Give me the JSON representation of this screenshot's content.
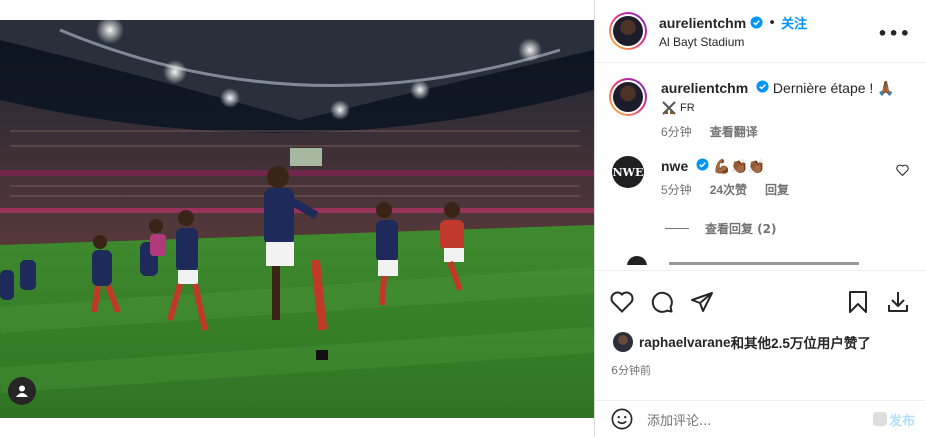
{
  "post": {
    "username": "aurelientchm",
    "dot": "•",
    "follow_label": "关注",
    "location": "Al Bayt Stadium",
    "more_label": "•••"
  },
  "caption": {
    "username": "aurelientchm",
    "text": "Dernière étape ! 🙏🏾",
    "flag_text": "FR",
    "time": "6分钟",
    "translate_label": "查看翻译"
  },
  "comment": {
    "username": "nwe",
    "avatar_text": "NWE",
    "text": "💪🏾👏🏾👏🏾",
    "time": "5分钟",
    "likes": "24次赞",
    "reply_label": "回复",
    "view_replies": "查看回复 (2)"
  },
  "likes": {
    "user": "raphaelvarane",
    "rest": "和其他2.5万位用户赞了"
  },
  "post_time": "6分钟前",
  "composer": {
    "placeholder": "添加评论...",
    "post_label": "发布"
  },
  "icons": {
    "verified": "verified-badge-icon",
    "heart": "heart-icon",
    "comment": "comment-icon",
    "share": "share-icon",
    "save": "bookmark-icon",
    "download": "download-icon",
    "emoji": "emoji-icon",
    "tag": "user-tag-icon"
  },
  "colors": {
    "accent": "#0095f6",
    "verified": "#0095f6",
    "muted": "#737373"
  }
}
